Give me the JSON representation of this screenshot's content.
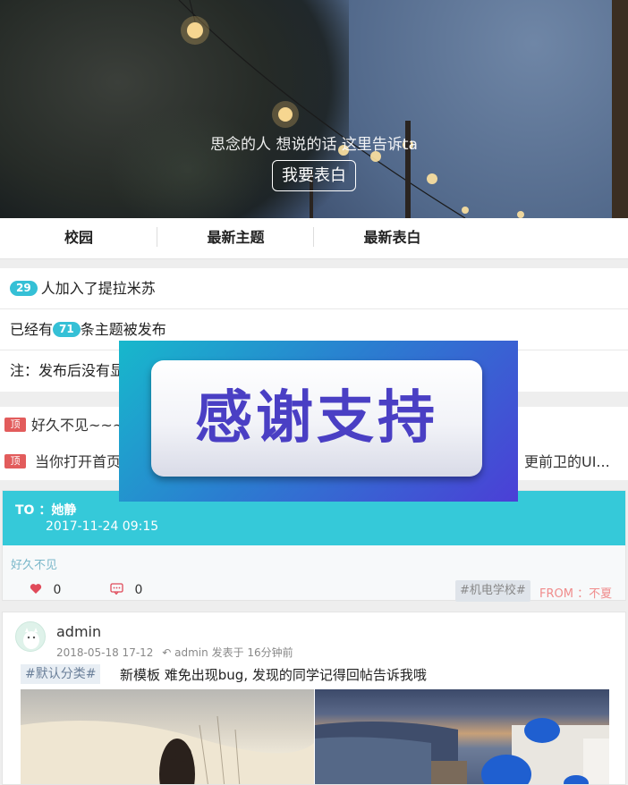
{
  "hero": {
    "title": "思念的人 想说的话 这里告诉ta",
    "button_label": "我要表白"
  },
  "tabs": [
    "校园",
    "最新主题",
    "最新表白"
  ],
  "info": {
    "members_count": "29",
    "members_text": "人加入了提拉米苏",
    "topics_prefix": "已经有",
    "topics_count": "71",
    "topics_suffix": "条主题被发布",
    "note": "注：发布后没有显"
  },
  "pinned": {
    "tag": "顶",
    "items": [
      {
        "text": "好久不见~~~",
        "trailing": ""
      },
      {
        "text": "当你打开首页",
        "trailing": "更前卫的UI..."
      }
    ]
  },
  "confession": {
    "to_label": "TO ：",
    "to_name": "她静",
    "date": "2017-11-24 09:15",
    "body": "好久不见",
    "likes": "0",
    "comments": "0",
    "tag": "#机电学校#",
    "from": "FROM ：不夏"
  },
  "post": {
    "user": "admin",
    "date": "2018-05-18 17-12",
    "author": "admin",
    "meta_suffix": "发表于 16分钟前",
    "category": "#默认分类#",
    "title": "新模板 难免出现bug, 发现的同学记得回帖告诉我哦"
  },
  "overlay": {
    "text": "感谢支持"
  },
  "colors": {
    "accent": "#35c9d9",
    "pin": "#e25c5c",
    "like": "#e04a5a"
  }
}
